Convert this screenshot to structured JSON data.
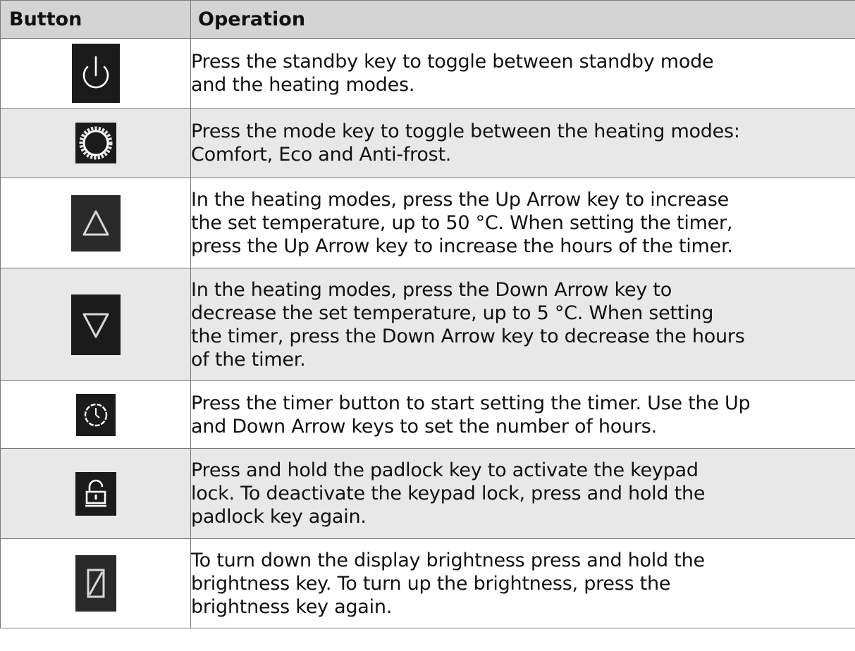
{
  "headers": {
    "button": "Button",
    "operation": "Operation"
  },
  "rows": [
    {
      "icon": "power-icon",
      "text": "Press the standby key to toggle between standby mode\nand the heating modes."
    },
    {
      "icon": "mode-gear-icon",
      "text": "Press the mode key to toggle between the heating modes:\nComfort, Eco and Anti-frost."
    },
    {
      "icon": "up-arrow-icon",
      "text": "In the heating modes, press the Up Arrow key to increase\nthe set temperature, up to 50 °C. When setting the timer,\npress the Up Arrow key to increase the hours of the timer."
    },
    {
      "icon": "down-arrow-icon",
      "text": "In the heating modes, press the Down Arrow key to\ndecrease the set temperature, up to 5 °C. When setting\nthe timer, press the Down Arrow key to decrease the hours\nof the timer."
    },
    {
      "icon": "timer-clock-icon",
      "text": "Press the timer button to start setting the timer. Use the Up\nand Down Arrow keys to set the number of hours."
    },
    {
      "icon": "padlock-icon",
      "text": "Press and hold the padlock key to activate the keypad\nlock. To deactivate the keypad lock, press and hold the\npadlock key again."
    },
    {
      "icon": "brightness-icon",
      "text": "To turn down the display brightness press and hold the\nbrightness key. To turn up the brightness, press the\nbrightness key again."
    }
  ],
  "colors": {
    "header_bg": "#d4d4d4",
    "shaded_row_bg": "#e8e8e8",
    "key_bg": "#1b1b1b",
    "border": "#7a7a7a"
  }
}
